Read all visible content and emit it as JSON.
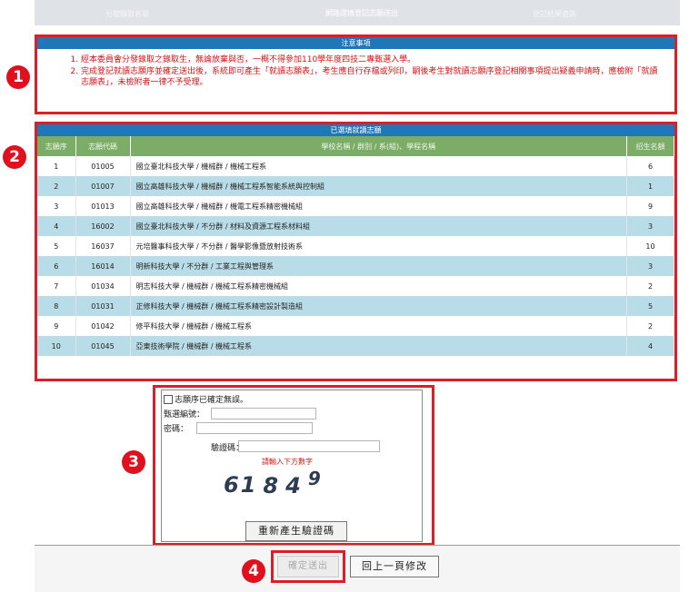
{
  "top_bar": {
    "left_text": "分發錄取名單",
    "title": "網路選填登記志願送出",
    "right_text": "登記結果查詢"
  },
  "markers": [
    "1",
    "2",
    "3",
    "4"
  ],
  "notice": {
    "title": "注意事項",
    "items": [
      "經本委員會分發錄取之錄取生，無論放棄與否，一概不得參加110學年度四技二專甄選入學。",
      "完成登記就讀志願序並確定送出後，系統即可產生「就讀志願表」，考生應自行存檔或列印，嗣後考生對就讀志願序登記相關事項提出疑義申請時，應檢附「就讀志願表」，未檢附者一律不予受理。"
    ]
  },
  "choices": {
    "title": "已選填就讀志願",
    "headers": [
      "志願序",
      "志願代碼",
      "學校名稱 / 群別 / 系(組)、學程名稱",
      "招生名額"
    ],
    "rows": [
      {
        "seq": "1",
        "code": "01005",
        "name": "國立臺北科技大學 / 機械群 / 機械工程系",
        "quota": "6"
      },
      {
        "seq": "2",
        "code": "01007",
        "name": "國立高雄科技大學 / 機械群 / 機械工程系智能系統與控制組",
        "quota": "1"
      },
      {
        "seq": "3",
        "code": "01013",
        "name": "國立高雄科技大學 / 機械群 / 機電工程系精密機械組",
        "quota": "9"
      },
      {
        "seq": "4",
        "code": "16002",
        "name": "國立臺北科技大學 / 不分群 / 材料及資源工程系材料組",
        "quota": "3"
      },
      {
        "seq": "5",
        "code": "16037",
        "name": "元培醫事科技大學 / 不分群 / 醫學影像暨放射技術系",
        "quota": "10"
      },
      {
        "seq": "6",
        "code": "16014",
        "name": "明新科技大學 / 不分群 / 工業工程與管理系",
        "quota": "3"
      },
      {
        "seq": "7",
        "code": "01034",
        "name": "明志科技大學 / 機械群 / 機械工程系精密機械組",
        "quota": "2"
      },
      {
        "seq": "8",
        "code": "01031",
        "name": "正修科技大學 / 機械群 / 機械工程系精密設計製造組",
        "quota": "5"
      },
      {
        "seq": "9",
        "code": "01042",
        "name": "修平科技大學 / 機械群 / 機械工程系",
        "quota": "2"
      },
      {
        "seq": "10",
        "code": "01045",
        "name": "亞東技術學院 / 機械群 / 機械工程系",
        "quota": "4"
      }
    ]
  },
  "login": {
    "confirm_check_label": "志願序已確定無誤。",
    "id_label": "甄選編號：",
    "id_value": "",
    "password_label": "密碼：",
    "password_value": "",
    "captcha_label": "驗證碼：",
    "captcha_value": "",
    "captcha_hint": "請輸入下方數字",
    "captcha_digits": [
      "61",
      "8",
      "4",
      "9"
    ],
    "regenerate_label": "重新產生驗證碼"
  },
  "actions": {
    "confirm_label": "確定送出",
    "back_label": "回上一頁修改"
  }
}
